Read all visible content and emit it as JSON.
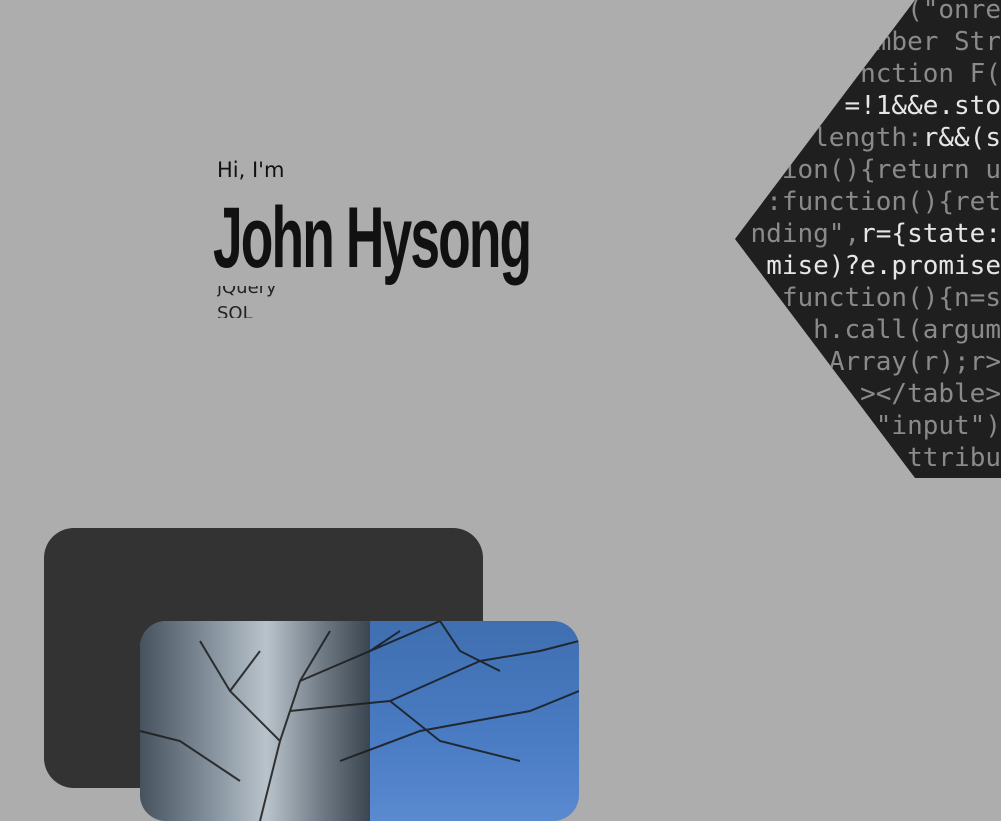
{
  "hero": {
    "greeting": "Hi, I'm",
    "name": "John Hysong",
    "skills": [
      "jQuery",
      "SQL"
    ]
  },
  "code_background": {
    "lines": [
      {
        "dim": "(\"onre",
        "bright": ""
      },
      {
        "dim": "mber Str",
        "bright": ""
      },
      {
        "dim": "nction F(",
        "bright": ""
      },
      {
        "dim": "",
        "bright": "=!1&&e.sto"
      },
      {
        "dim": "length:",
        "bright": "r&&(s"
      },
      {
        "dim": "ion(){return u",
        "bright": ""
      },
      {
        "dim": ":function(){ret",
        "bright": ""
      },
      {
        "dim": "nding\",",
        "bright": "r={state:"
      },
      {
        "dim": "",
        "bright": "mise)?e.promise"
      },
      {
        "dim": "function(){n=s",
        "bright": ""
      },
      {
        "dim": "h.call(argum",
        "bright": ""
      },
      {
        "dim": "Array(r);r>",
        "bright": ""
      },
      {
        "dim": "></table>",
        "bright": ""
      },
      {
        "dim": "\"input\")",
        "bright": ""
      },
      {
        "dim": "ttribu",
        "bright": ""
      }
    ]
  },
  "colors": {
    "background": "#adadad",
    "card": "#333333",
    "code_panel": "#1f1f1f",
    "text": "#111111"
  },
  "photo": {
    "icon": "campus-photo"
  }
}
